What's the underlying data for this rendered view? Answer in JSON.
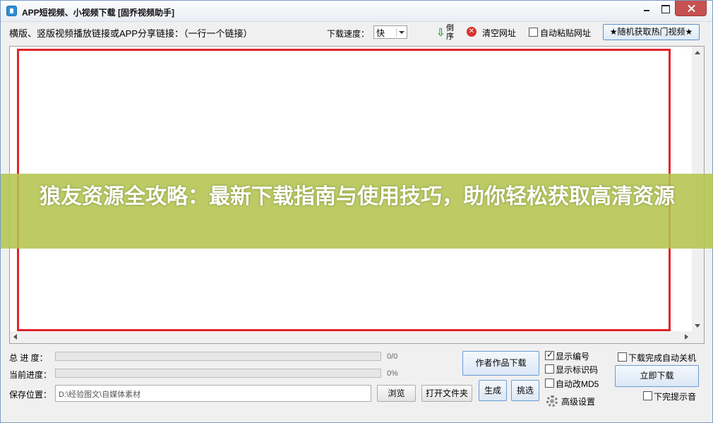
{
  "window": {
    "title": "APP短视频、小视频下载 [固乔视频助手]"
  },
  "toolbar": {
    "url_label": "横版、竖版视频播放链接或APP分享链接：（一行一个链接）",
    "speed_label": "下载速度：",
    "speed_value": "快",
    "reverse_label": "倒序",
    "clear_label": "清空网址",
    "auto_paste_label": "自动粘贴网址",
    "auto_paste_checked": false,
    "random_hot_label": "★随机获取热门视频★"
  },
  "banner": {
    "text": "狼友资源全攻略：最新下载指南与使用技巧，助你轻松获取高清资源"
  },
  "status": {
    "total_label": "总  进  度：",
    "total_value": "0/0",
    "total_progress": 0,
    "current_label": "当前进度：",
    "current_value": "0%",
    "current_progress": 0,
    "save_label": "保存位置：",
    "save_path": "D:\\经验图文\\自媒体素材"
  },
  "actions": {
    "browse": "浏览",
    "open_folder": "打开文件夹",
    "author_download": "作者作品下载",
    "generate": "生成",
    "pick": "挑选",
    "download_now": "立即下载",
    "advanced": "高级设置"
  },
  "options": {
    "show_number": {
      "label": "显示编号",
      "checked": true
    },
    "show_mark": {
      "label": "显示标识码",
      "checked": false
    },
    "auto_md5": {
      "label": "自动改MD5",
      "checked": false
    },
    "auto_shutdown": {
      "label": "下载完成自动关机",
      "checked": false
    },
    "done_sound": {
      "label": "下完提示音",
      "checked": false
    }
  },
  "colors": {
    "highlight_border": "#e2232a",
    "banner_bg": "#b4c450",
    "progress_fill": "#06b025"
  }
}
